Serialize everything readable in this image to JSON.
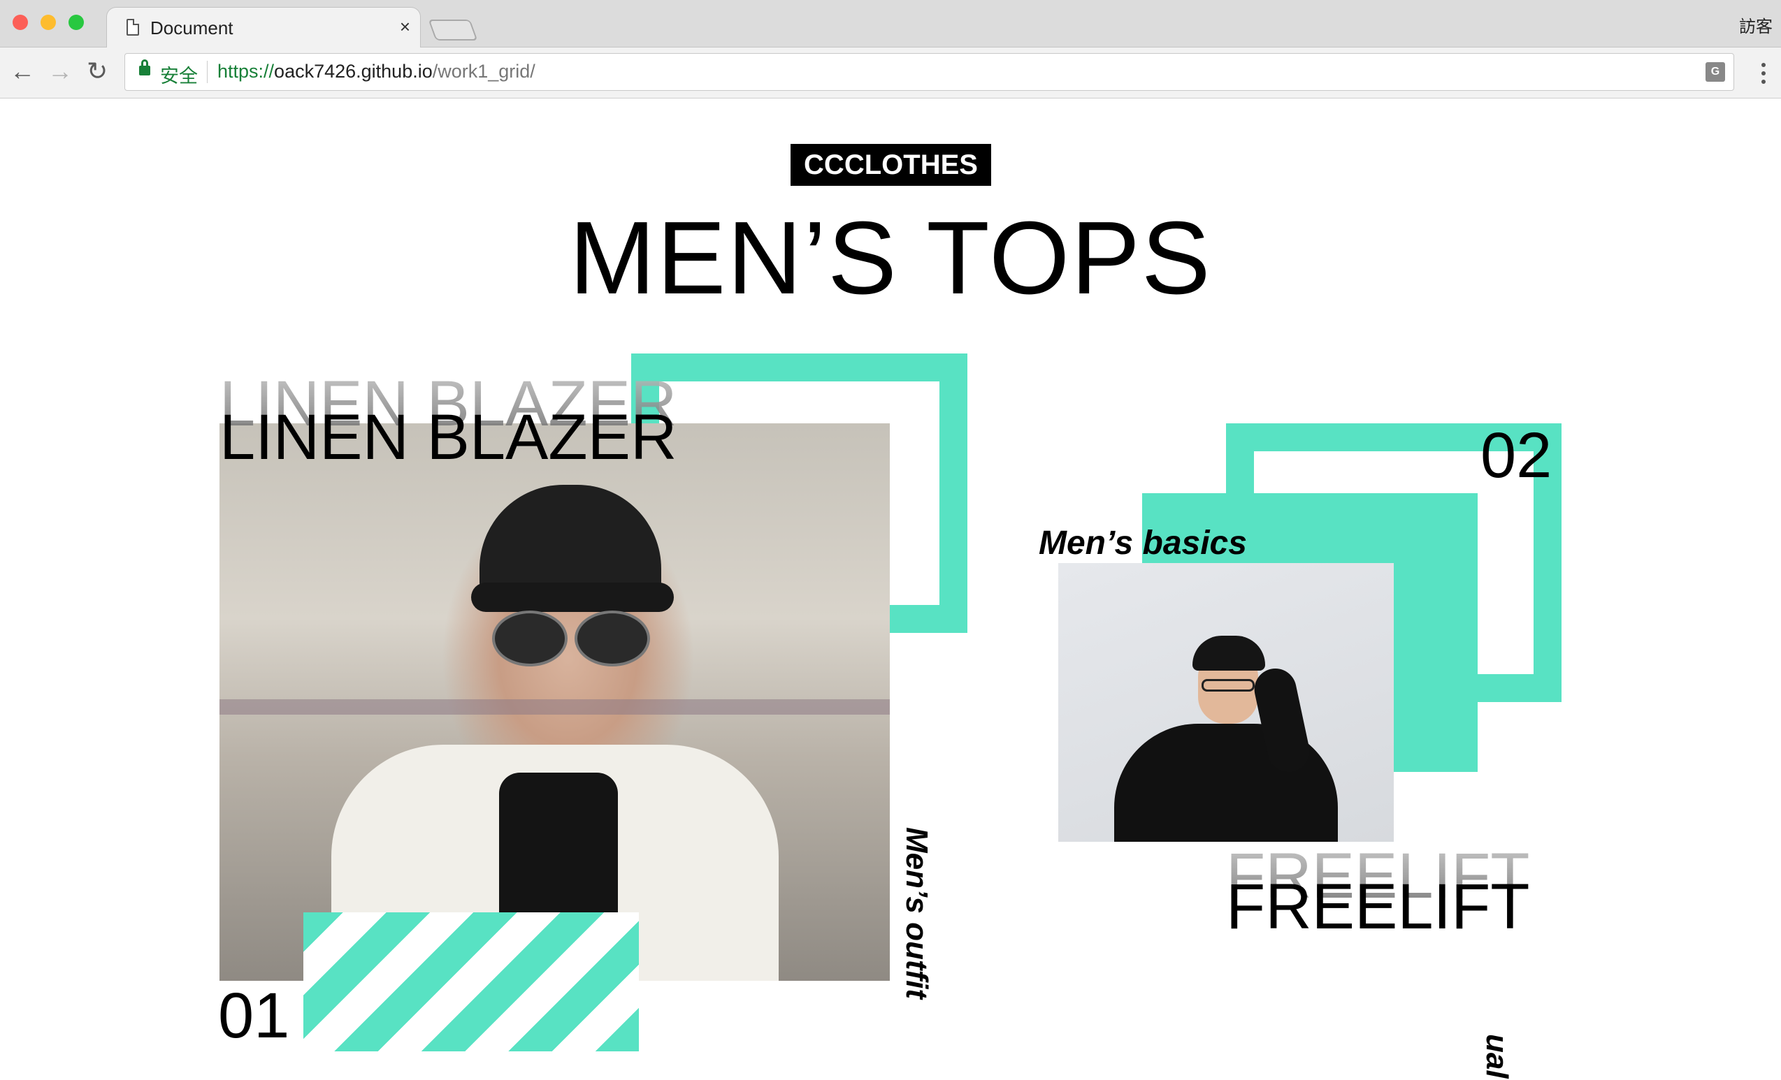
{
  "browser": {
    "tab_title": "Document",
    "tab_close": "×",
    "user_label": "訪客",
    "secure_label": "安全",
    "url_scheme": "https://",
    "url_host": "oack7426.github.io",
    "url_path": "/work1_grid/",
    "back_icon": "←",
    "forward_icon": "→",
    "reload_icon": "↻",
    "translate_icon": "G"
  },
  "page": {
    "brand": "CCCLOTHES",
    "headline": "MEN’S TOPS",
    "colors": {
      "accent": "#58e2c3",
      "ink": "#000000"
    },
    "cards": [
      {
        "number": "01",
        "title": "LINEN BLAZER",
        "caption": "Men’s outfit"
      },
      {
        "number": "02",
        "title": "FREELIFT",
        "caption": "Men’s basics"
      }
    ],
    "third_caption_fragment": "ual"
  }
}
